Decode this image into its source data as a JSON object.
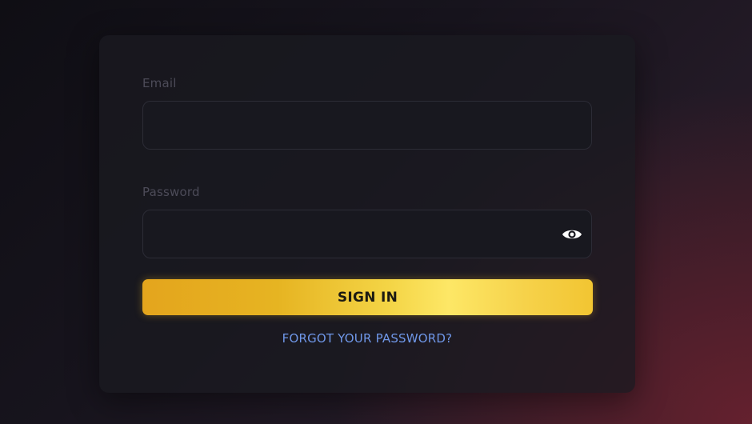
{
  "form": {
    "email": {
      "label": "Email",
      "value": "",
      "placeholder": ""
    },
    "password": {
      "label": "Password",
      "value": "",
      "placeholder": "",
      "toggle_icon": "eye-icon"
    },
    "submit_label": "SIGN IN",
    "forgot_label": "FORGOT YOUR PASSWORD?"
  },
  "colors": {
    "accent": "#f2c532",
    "link": "#6f97e8",
    "card": "#1a1a20",
    "label": "#4c4b58"
  }
}
